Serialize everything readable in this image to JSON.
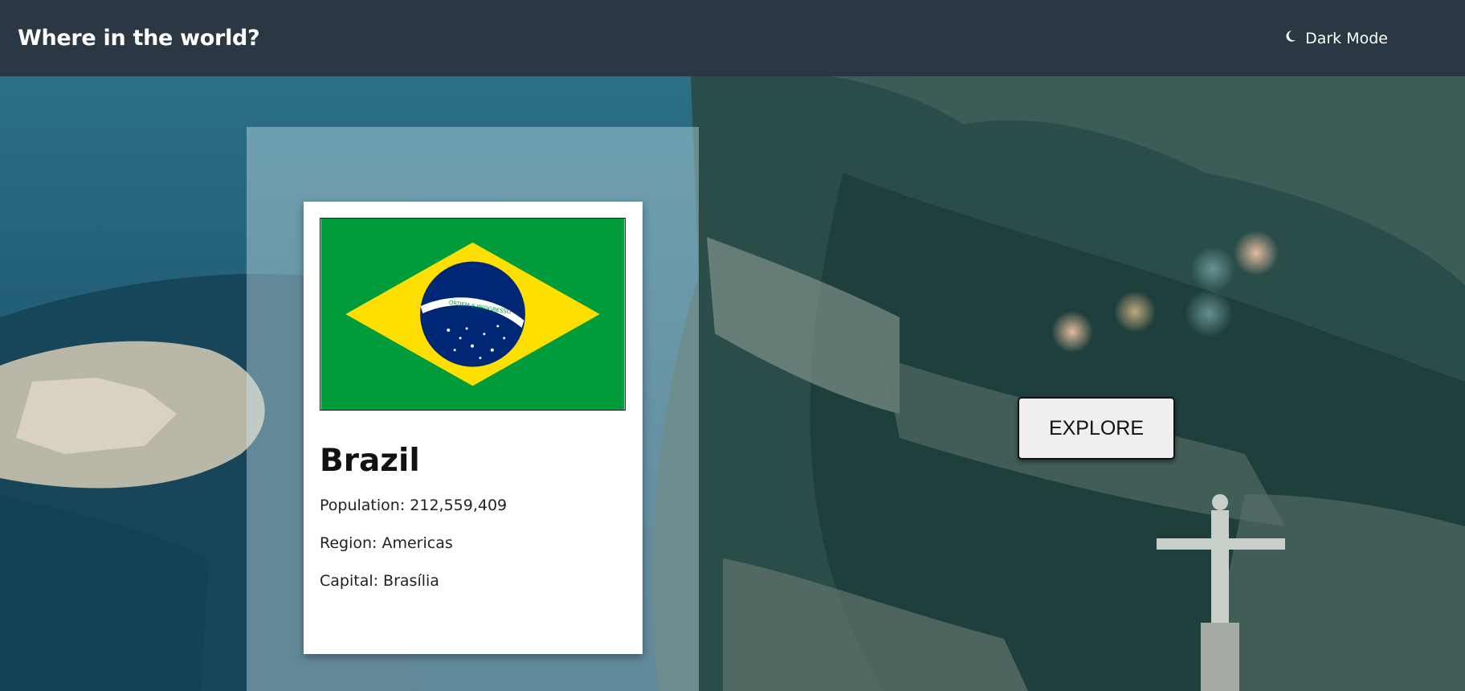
{
  "header": {
    "title": "Where in the world?",
    "mode_label": "Dark Mode",
    "mode_icon": "moon-icon"
  },
  "card": {
    "flag_icon": "brazil-flag",
    "flag_motto": "ORDEM E PROGRESSO",
    "name": "Brazil",
    "population": "Population: 212,559,409",
    "region": "Region: Americas",
    "capital": "Capital: Brasília"
  },
  "explore": {
    "label": "EXPLORE"
  },
  "colors": {
    "header_bg": "#2b3743",
    "flag_green": "#009c3b",
    "flag_yellow": "#ffdf00",
    "flag_blue": "#002776"
  }
}
